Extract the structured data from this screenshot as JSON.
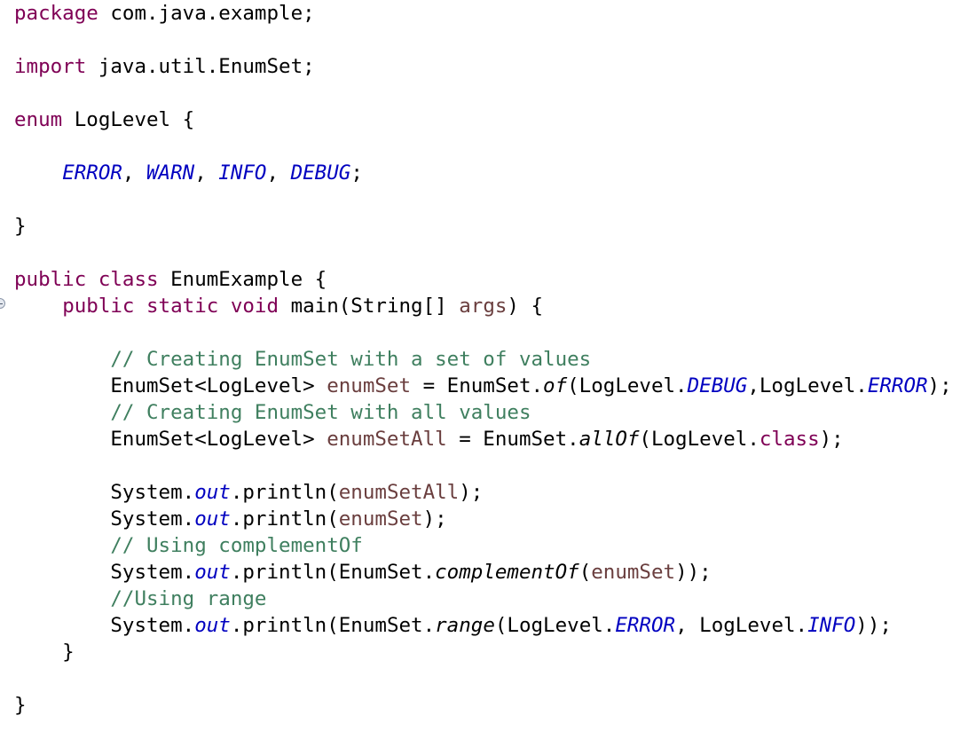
{
  "editor": {
    "lines": [
      [
        {
          "t": "package",
          "c": "kw"
        },
        {
          "t": " com.java.example;"
        }
      ],
      [],
      [
        {
          "t": "import",
          "c": "kw"
        },
        {
          "t": " java.util.EnumSet;"
        }
      ],
      [],
      [
        {
          "t": "enum",
          "c": "kw"
        },
        {
          "t": " LogLevel {"
        }
      ],
      [],
      [
        {
          "t": "    "
        },
        {
          "t": "ERROR",
          "c": "ef"
        },
        {
          "t": ", "
        },
        {
          "t": "WARN",
          "c": "ef"
        },
        {
          "t": ", "
        },
        {
          "t": "INFO",
          "c": "ef"
        },
        {
          "t": ", "
        },
        {
          "t": "DEBUG",
          "c": "ef"
        },
        {
          "t": ";"
        }
      ],
      [],
      [
        {
          "t": "}"
        }
      ],
      [],
      [
        {
          "t": "public",
          "c": "kw"
        },
        {
          "t": " "
        },
        {
          "t": "class",
          "c": "kw"
        },
        {
          "t": " EnumExample {"
        }
      ],
      [
        {
          "t": "    "
        },
        {
          "t": "public",
          "c": "kw"
        },
        {
          "t": " "
        },
        {
          "t": "static",
          "c": "kw"
        },
        {
          "t": " "
        },
        {
          "t": "void",
          "c": "kw"
        },
        {
          "t": " main(String[] "
        },
        {
          "t": "args",
          "c": "lv"
        },
        {
          "t": ") {"
        }
      ],
      [],
      [
        {
          "t": "        "
        },
        {
          "t": "// Creating EnumSet with a set of values",
          "c": "cm"
        }
      ],
      [
        {
          "t": "        EnumSet<LogLevel> "
        },
        {
          "t": "enumSet",
          "c": "lv"
        },
        {
          "t": " = EnumSet."
        },
        {
          "t": "of",
          "c": "sm"
        },
        {
          "t": "(LogLevel."
        },
        {
          "t": "DEBUG",
          "c": "ef"
        },
        {
          "t": ",LogLevel."
        },
        {
          "t": "ERROR",
          "c": "ef"
        },
        {
          "t": ");"
        }
      ],
      [
        {
          "t": "        "
        },
        {
          "t": "// Creating EnumSet with all values",
          "c": "cm"
        }
      ],
      [
        {
          "t": "        EnumSet<LogLevel> "
        },
        {
          "t": "enumSetAll",
          "c": "lv"
        },
        {
          "t": " = EnumSet."
        },
        {
          "t": "allOf",
          "c": "sm"
        },
        {
          "t": "(LogLevel."
        },
        {
          "t": "class",
          "c": "kw"
        },
        {
          "t": ");"
        }
      ],
      [],
      [
        {
          "t": "        System."
        },
        {
          "t": "out",
          "c": "st"
        },
        {
          "t": ".println("
        },
        {
          "t": "enumSetAll",
          "c": "lv"
        },
        {
          "t": ");"
        }
      ],
      [
        {
          "t": "        System."
        },
        {
          "t": "out",
          "c": "st"
        },
        {
          "t": ".println("
        },
        {
          "t": "enumSet",
          "c": "lv"
        },
        {
          "t": ");"
        }
      ],
      [
        {
          "t": "        "
        },
        {
          "t": "// Using complementOf",
          "c": "cm"
        }
      ],
      [
        {
          "t": "        System."
        },
        {
          "t": "out",
          "c": "st"
        },
        {
          "t": ".println(EnumSet."
        },
        {
          "t": "complementOf",
          "c": "sm"
        },
        {
          "t": "("
        },
        {
          "t": "enumSet",
          "c": "lv"
        },
        {
          "t": "));"
        }
      ],
      [
        {
          "t": "        "
        },
        {
          "t": "//Using range",
          "c": "cm"
        }
      ],
      [
        {
          "t": "        System."
        },
        {
          "t": "out",
          "c": "st"
        },
        {
          "t": ".println(EnumSet."
        },
        {
          "t": "range",
          "c": "sm"
        },
        {
          "t": "(LogLevel."
        },
        {
          "t": "ERROR",
          "c": "ef"
        },
        {
          "t": ", LogLevel."
        },
        {
          "t": "INFO",
          "c": "ef"
        },
        {
          "t": "));"
        }
      ],
      [
        {
          "t": "    }"
        }
      ],
      [],
      [
        {
          "t": "}"
        }
      ]
    ]
  },
  "colors": {
    "keyword": "#7f0055",
    "comment": "#3f7f5f",
    "enum_field": "#0000c0",
    "local_variable": "#6a3e3e",
    "text": "#000000",
    "background": "#ffffff"
  },
  "gutter": {
    "fold_icon": "collapse-minus-icon"
  }
}
